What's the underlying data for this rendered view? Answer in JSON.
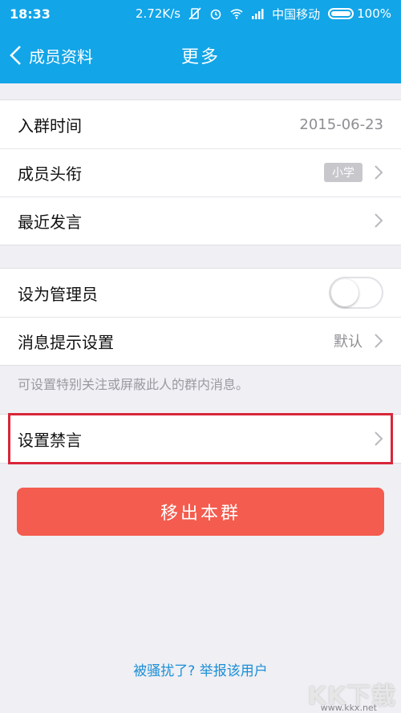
{
  "status_bar": {
    "time": "18:33",
    "speed": "2.72K/s",
    "carrier": "中国移动",
    "battery": "100%"
  },
  "nav": {
    "back_label": "成员资料",
    "title": "更多"
  },
  "group1": {
    "join_time_label": "入群时间",
    "join_time_value": "2015-06-23",
    "member_title_label": "成员头衔",
    "member_title_badge": "小学",
    "recent_posts_label": "最近发言"
  },
  "group2": {
    "set_admin_label": "设为管理员",
    "set_admin_on": false,
    "msg_setting_label": "消息提示设置",
    "msg_setting_value": "默认"
  },
  "hint_text": "可设置特别关注或屏蔽此人的群内消息。",
  "mute": {
    "label": "设置禁言"
  },
  "remove_button": "移出本群",
  "report_link": "被骚扰了? 举报该用户",
  "watermark": {
    "text": "KK下载",
    "url": "www.kkx.net"
  },
  "colors": {
    "accent": "#12a5e8",
    "danger": "#f35c4e",
    "highlight": "#d8263a",
    "link": "#1a8fd6"
  }
}
